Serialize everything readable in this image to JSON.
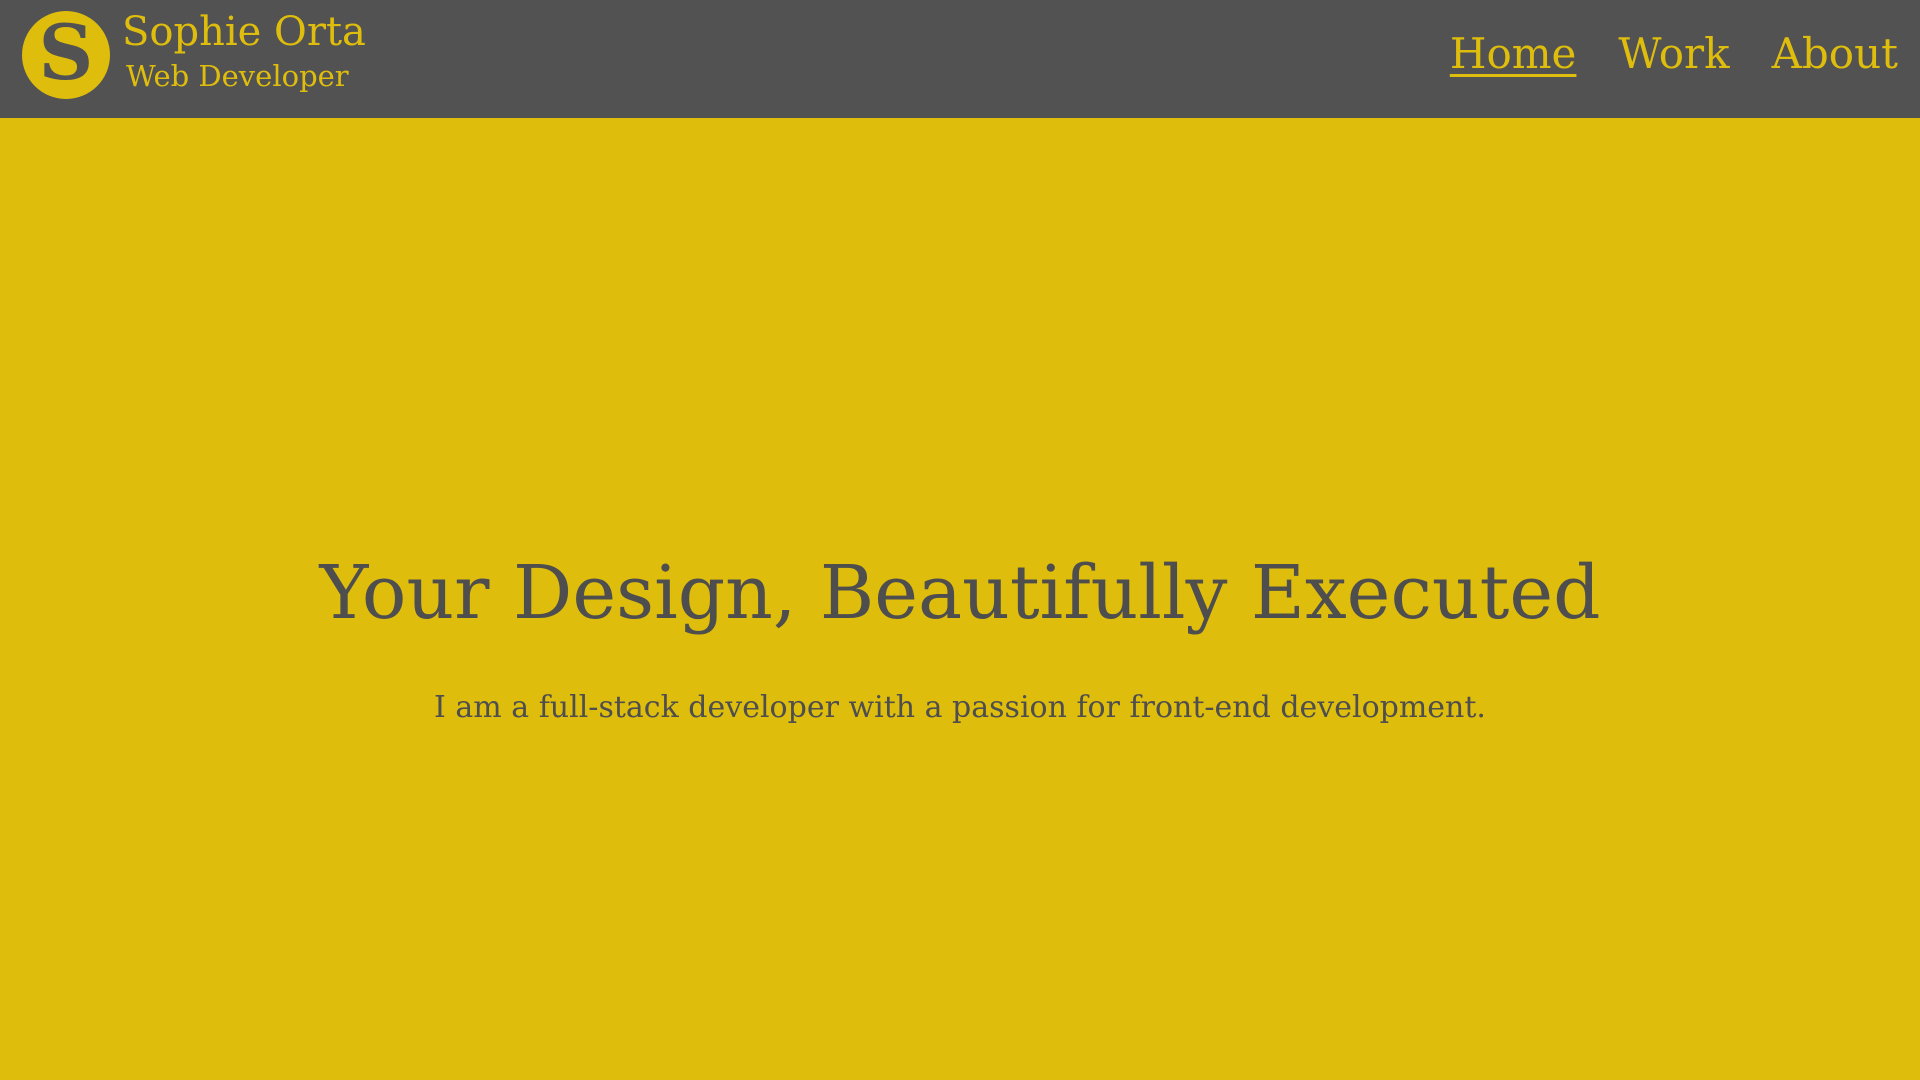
{
  "header": {
    "logo_letter": "S",
    "brand_name": "Sophie Orta",
    "brand_tagline": "Web Developer",
    "nav": [
      {
        "label": "Home",
        "active": true
      },
      {
        "label": "Work",
        "active": false
      },
      {
        "label": "About",
        "active": false
      }
    ]
  },
  "hero": {
    "title": "Your Design, Beautifully Executed",
    "subtitle": "I am a full-stack developer with a passion for front-end development."
  },
  "colors": {
    "header_bg": "#525252",
    "accent": "#dfbd0d",
    "text_dark": "#4e4e4e"
  }
}
